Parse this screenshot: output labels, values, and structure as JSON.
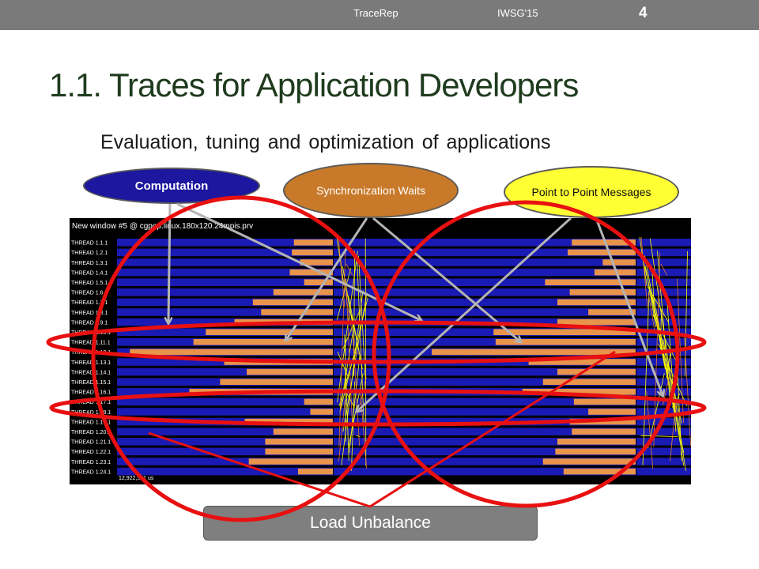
{
  "header": {
    "left_text": "TraceRep",
    "right_text": "IWSG'15",
    "page_number": "4"
  },
  "title": "1.1. Traces for Application Developers",
  "subtitle": "Evaluation, tuning and optimization of applications",
  "ovals": {
    "computation": "Computation",
    "sync": "Synchronization Waits",
    "p2p": "Point to Point Messages"
  },
  "trace": {
    "window_title": "New window #5 @ cgpop.linux.180x120.24mpis.prv",
    "footer": "12,922,581 us",
    "threads": [
      "THREAD 1.1.1",
      "THREAD 1.2.1",
      "THREAD 1.3.1",
      "THREAD 1.4.1",
      "THREAD 1.5.1",
      "THREAD 1.6.1",
      "THREAD 1.7.1",
      "THREAD 1.8.1",
      "THREAD 1.9.1",
      "THREAD 1.10.1",
      "THREAD 1.11.1",
      "THREAD 1.12.1",
      "THREAD 1.13.1",
      "THREAD 1.14.1",
      "THREAD 1.15.1",
      "THREAD 1.16.1",
      "THREAD 1.17.1",
      "THREAD 1.18.1",
      "THREAD 1.19.1",
      "THREAD 1.20.1",
      "THREAD 1.21.1",
      "THREAD 1.22.1",
      "THREAD 1.23.1",
      "THREAD 1.24.1"
    ],
    "wait_phase1": [
      0.19,
      0.2,
      0.16,
      0.21,
      0.14,
      0.29,
      0.39,
      0.35,
      0.48,
      0.62,
      0.68,
      0.99,
      0.53,
      0.42,
      0.55,
      0.7,
      0.14,
      0.11,
      0.43,
      0.29,
      0.33,
      0.33,
      0.41,
      0.17
    ],
    "wait_phase2": [
      0.31,
      0.33,
      0.16,
      0.2,
      0.44,
      0.32,
      0.38,
      0.23,
      0.38,
      0.69,
      0.68,
      0.99,
      0.52,
      0.38,
      0.45,
      0.55,
      0.3,
      0.23,
      0.32,
      0.31,
      0.38,
      0.39,
      0.45,
      0.35
    ],
    "colors": {
      "computation": "#1a1ab4",
      "sync": "#e8944a",
      "p2p": "#ffff00",
      "background": "#000000",
      "annotation": "#e81010",
      "arrow": "#b4b4b4"
    }
  },
  "load_unbalance": "Load Unbalance"
}
